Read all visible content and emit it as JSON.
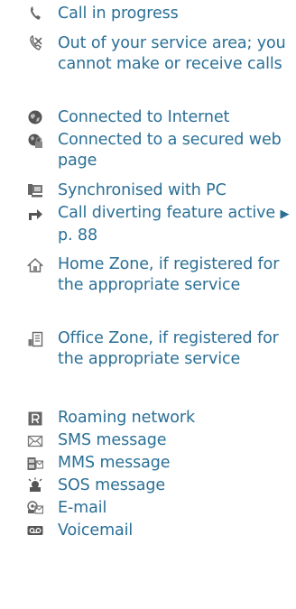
{
  "status_icons": [
    {
      "icon": "phone-handset-icon",
      "text": "Call in progress"
    },
    {
      "icon": "phone-crossed-icon",
      "text": "Out of your service area; you cannot make or receive calls"
    },
    {
      "icon": "globe-icon",
      "text": "Connected to Internet"
    },
    {
      "icon": "globe-lock-icon",
      "text": "Connected to a secured web page"
    },
    {
      "icon": "pc-sync-icon",
      "text": "Synchronised with PC"
    },
    {
      "icon": "divert-arrow-icon",
      "text_before": "Call diverting feature active",
      "arrow": "▶",
      "text_after": "p. 88"
    },
    {
      "icon": "home-icon",
      "text": "Home Zone, if registered for the appropriate service"
    },
    {
      "icon": "office-icon",
      "text": "Office Zone, if registered for the appropriate service"
    },
    {
      "icon": "roaming-r-icon",
      "text": "Roaming network"
    },
    {
      "icon": "envelope-icon",
      "text": "SMS message"
    },
    {
      "icon": "mms-icon",
      "text": "MMS message"
    },
    {
      "icon": "sos-icon",
      "text": "SOS message"
    },
    {
      "icon": "email-icon",
      "text": "E-mail"
    },
    {
      "icon": "voicemail-icon",
      "text": "Voicemail"
    }
  ],
  "colors": {
    "text": "#2a6f96",
    "icon_dark": "#555555",
    "icon_light": "#9a9a9a"
  }
}
